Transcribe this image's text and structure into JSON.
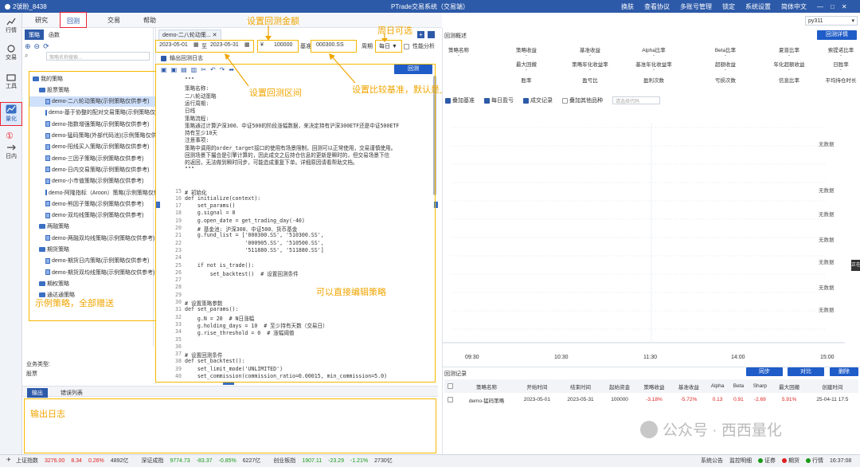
{
  "titlebar": {
    "user": "2號盼_8438",
    "title": "PTrade交易系统（交易端）",
    "actions": [
      "换肤",
      "查看协议",
      "多账号管理",
      "锁定",
      "系统设置",
      "简体中文"
    ]
  },
  "rail": [
    {
      "label": "行情",
      "icon": "chart-icon"
    },
    {
      "label": "交易",
      "icon": "trade-icon"
    },
    {
      "label": "工具",
      "icon": "toolbox-icon"
    },
    {
      "label": "量化",
      "icon": "quant-icon",
      "active": true
    },
    {
      "label": "日内",
      "icon": "intraday-icon"
    }
  ],
  "rail_marker": "①",
  "menu": {
    "items": [
      "研究",
      "回测",
      "交易",
      "帮助"
    ],
    "active": "回测",
    "marker": "②"
  },
  "strategy_panel": {
    "tabs": [
      "策略",
      "函数"
    ],
    "search_placeholder": "策略名称搜索...",
    "tree": [
      {
        "type": "folder",
        "label": "我的策略",
        "level": 0
      },
      {
        "type": "folder",
        "label": "股票策略",
        "level": 1
      },
      {
        "type": "file",
        "label": "demo-二八轮动策略(示例策略仅供参考)",
        "level": 2,
        "selected": true
      },
      {
        "type": "file",
        "label": "demo-基于协整的配对交易策略(示例策略仅供参考)",
        "level": 2
      },
      {
        "type": "file",
        "label": "demo-指数增强策略(示例策略仅供参考)",
        "level": 2
      },
      {
        "type": "file",
        "label": "demo-猛码策略(外部代码池)(示例策略仅供参考)",
        "level": 2
      },
      {
        "type": "file",
        "label": "demo-阳线买入策略(示例策略仅供参考)",
        "level": 2
      },
      {
        "type": "file",
        "label": "demo-三因子策略(示例策略仅供参考)",
        "level": 2
      },
      {
        "type": "file",
        "label": "demo-日内交易策略(示例策略仅供参考)",
        "level": 2
      },
      {
        "type": "file",
        "label": "demo-小市值策略(示例策略仅供参考)",
        "level": 2
      },
      {
        "type": "file",
        "label": "demo-阿隆指标（Aroon）策略(示例策略仅供参考)",
        "level": 2
      },
      {
        "type": "file",
        "label": "demo-熊因子策略(示例策略仅供参考)",
        "level": 2
      },
      {
        "type": "file",
        "label": "demo-双均线策略(示例策略仅供参考)",
        "level": 2
      },
      {
        "type": "folder",
        "label": "两融策略",
        "level": 1
      },
      {
        "type": "file",
        "label": "demo-两融双均线策略(示例策略仅供参考)",
        "level": 2
      },
      {
        "type": "folder",
        "label": "期货策略",
        "level": 1
      },
      {
        "type": "file",
        "label": "demo-期货日内策略(示例策略仅供参考)",
        "level": 2
      },
      {
        "type": "file",
        "label": "demo-期货双均线策略(示例策略仅供参考)",
        "level": 2
      },
      {
        "type": "folder",
        "label": "期权策略",
        "level": 1
      },
      {
        "type": "folder",
        "label": "通达通策略",
        "level": 1
      }
    ],
    "note": "示例策略，全部赠送",
    "business_type_label": "业务类型:",
    "business_type_value": "股票"
  },
  "editor": {
    "tab_label": "demo-二八轮动策...",
    "start_date": "2023-05-01",
    "to_label": "至",
    "end_date": "2023-05-31",
    "capital_label": "¥",
    "capital": "100000",
    "benchmark_label": "基准",
    "benchmark": "000300.SS",
    "period_label": "周期",
    "period": "每日",
    "perf_label": "性能分析",
    "log_check_label": "输出回测日志",
    "run_button": "回测",
    "code": [
      {
        "n": "",
        "t": "\"\"\"",
        "c": "str"
      },
      {
        "n": "",
        "t": "策略名称:",
        "c": "str"
      },
      {
        "n": "",
        "t": "二八轮动策略",
        "c": "str"
      },
      {
        "n": "",
        "t": "运行周期:",
        "c": "str"
      },
      {
        "n": "",
        "t": "日线",
        "c": "str"
      },
      {
        "n": "",
        "t": "策略流程:",
        "c": "str"
      },
      {
        "n": "",
        "t": "策略通过计算沪深300、中证500的阶段涨幅数据，来决定持有沪深300ETF还是中证500ETF",
        "c": "str"
      },
      {
        "n": "",
        "t": "持有至少10天",
        "c": "str"
      },
      {
        "n": "",
        "t": "注意事项:",
        "c": "str"
      },
      {
        "n": "",
        "t": "策略中调用的order_target接口的使用有场景限制，回测可以正常使用，交易谨慎使用。",
        "c": "str"
      },
      {
        "n": "",
        "t": "回测场景下撮合是引擎计算的，因此成交之后持仓信息的更新是瞬时的，但交易场景下信",
        "c": "str"
      },
      {
        "n": "",
        "t": "的返回，无法做到瞬时同步，可能造成重复下单。详细原因请看帮助文档。",
        "c": "str"
      },
      {
        "n": "",
        "t": "\"\"\"",
        "c": "str"
      },
      {
        "n": "",
        "t": "",
        "c": ""
      },
      {
        "n": "",
        "t": "",
        "c": ""
      },
      {
        "n": "15",
        "t": "# 初始化",
        "c": "cm"
      },
      {
        "n": "16",
        "t": "def initialize(context):",
        "c": "kw"
      },
      {
        "n": "17",
        "t": "    set_params()",
        "c": ""
      },
      {
        "n": "18",
        "t": "    g.signal = 0",
        "c": ""
      },
      {
        "n": "19",
        "t": "    g.open_date = get_trading_day(-40)",
        "c": ""
      },
      {
        "n": "20",
        "t": "    # 基金池: 沪深300、中证500、货币基金",
        "c": "cm"
      },
      {
        "n": "21",
        "t": "    g.fund_list = ['000300.SS', '510300.SS',",
        "c": ""
      },
      {
        "n": "22",
        "t": "                   '000905.SS', '510500.SS',",
        "c": ""
      },
      {
        "n": "23",
        "t": "                   '511880.SS', '511880.SS']",
        "c": ""
      },
      {
        "n": "24",
        "t": "",
        "c": ""
      },
      {
        "n": "25",
        "t": "    if not is_trade():",
        "c": "kw"
      },
      {
        "n": "26",
        "t": "        set_backtest()  # 设置回测条件",
        "c": ""
      },
      {
        "n": "27",
        "t": "",
        "c": ""
      },
      {
        "n": "28",
        "t": "",
        "c": ""
      },
      {
        "n": "29",
        "t": "",
        "c": ""
      },
      {
        "n": "30",
        "t": "# 设置策略参数",
        "c": "cm"
      },
      {
        "n": "31",
        "t": "def set_params():",
        "c": "kw"
      },
      {
        "n": "32",
        "t": "    g.N = 20  # N日涨幅",
        "c": ""
      },
      {
        "n": "33",
        "t": "    g.holding_days = 10  # 至少持有天数（交易日）",
        "c": ""
      },
      {
        "n": "34",
        "t": "    g.rise_threshold = 0  # 涨幅阈值",
        "c": ""
      },
      {
        "n": "35",
        "t": "",
        "c": ""
      },
      {
        "n": "36",
        "t": "",
        "c": ""
      },
      {
        "n": "37",
        "t": "# 设置回测条件",
        "c": "cm"
      },
      {
        "n": "38",
        "t": "def set_backtest():",
        "c": "kw"
      },
      {
        "n": "39",
        "t": "    set_limit_mode('UNLIMITED')",
        "c": ""
      },
      {
        "n": "40",
        "t": "    set_commission(commission_ratio=0.00015, min_commission=5.0)",
        "c": ""
      }
    ]
  },
  "notes": {
    "capital": "设置回测金额",
    "period": "周日可选",
    "range": "设置回测区间",
    "benchmark": "设置比较基准，默认是上证指数",
    "edit": "可以直接编辑策略",
    "log": "输出日志"
  },
  "log_panel": {
    "tabs": [
      "输出",
      "错误列表"
    ]
  },
  "right": {
    "env": "py311",
    "title": "回测概述",
    "detail_button": "回测详情",
    "stats_row1": [
      "策略名称",
      "策略收益",
      "基准收益",
      "Alpha比率",
      "Beta比率",
      "夏普比率",
      "索提诺比率"
    ],
    "stats_row2": [
      "最大回撤",
      "策略年化收益率",
      "基准年化收益率",
      "超额收益",
      "年化超额收益",
      "日胜率"
    ],
    "stats_row3": [
      "胜率",
      "盈亏比",
      "盈利次数",
      "亏损次数",
      "信息比率",
      "平均持仓时长"
    ],
    "placeholder": "-",
    "checks": [
      {
        "label": "叠加基准",
        "on": true
      },
      {
        "label": "每日盈亏",
        "on": true
      },
      {
        "label": "成交记录",
        "on": true
      },
      {
        "label": "叠加其他品种",
        "on": false
      }
    ],
    "overlay_placeholder": "请选择代码",
    "no_data": "无数据",
    "side_tag": "正在",
    "x_ticks": [
      "09:30",
      "10:30",
      "11:30",
      "14:00",
      "15:00"
    ],
    "records_title": "回测记录",
    "record_buttons": [
      "同步",
      "对比",
      "删除"
    ],
    "columns": [
      "策略名称",
      "开始时间",
      "结束时间",
      "起始资金",
      "策略收益",
      "基准收益",
      "Alpha",
      "Beta",
      "Sharp",
      "最大回撤",
      "创建时间"
    ],
    "rows": [
      [
        "demo-猛码策略",
        "2023-05-01",
        "2023-05-31",
        "100000",
        "-3.18%",
        "-5.72%",
        "0.13",
        "0.91",
        "-2.69",
        "5.91%",
        "25-04-11 17:5"
      ]
    ],
    "watermark": "公众号 · 西西量化"
  },
  "status": {
    "indices": [
      {
        "name": "上证指数",
        "price": "3276.00",
        "chg": "8.34",
        "pct": "0.26%",
        "vol": "4892亿",
        "dir": "up"
      },
      {
        "name": "深证成指",
        "price": "9774.73",
        "chg": "-83.37",
        "pct": "-0.85%",
        "vol": "6227亿",
        "dir": "dn"
      },
      {
        "name": "创业板指",
        "price": "1907.11",
        "chg": "-23.29",
        "pct": "-1.21%",
        "vol": "2730亿",
        "dir": "dn"
      }
    ],
    "right": [
      "系统公告",
      "监控明细",
      "证券",
      "期货",
      "行情"
    ],
    "time": "16:37:08"
  },
  "colors": {
    "primary": "#2d5aa8",
    "accent_red": "#e23",
    "note": "#f0a500",
    "up": "#e02020",
    "down": "#1a9a1a"
  }
}
